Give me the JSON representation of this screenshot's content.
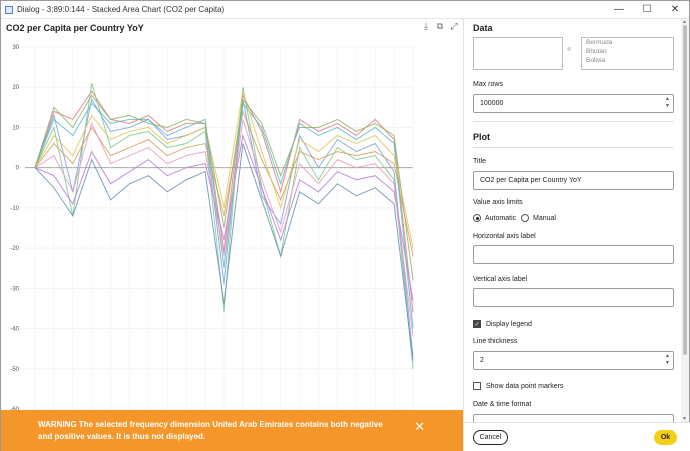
{
  "window": {
    "title": "Dialog - 3:89:0:144 - Stacked Area Chart (CO2 per Capita)",
    "minimize": "—",
    "maximize": "☐",
    "close": "✕"
  },
  "chart_panel": {
    "title": "CO2 per Capita per Country YoY",
    "icons": [
      "download-icon",
      "copy-icon",
      "expand-icon"
    ]
  },
  "chart_data": {
    "type": "line",
    "title": "CO2 per Capita per Country YoY",
    "xlabel": "",
    "ylabel": "",
    "ylim": [
      -60,
      30
    ],
    "yticks": [
      30,
      20,
      10,
      0,
      -10,
      -20,
      -30,
      -40,
      -50,
      -60
    ],
    "ytick_labels": [
      "30",
      "20",
      "10",
      "0",
      "-10",
      "-20",
      "-30",
      "-40",
      "-50",
      "-60"
    ],
    "grid": true,
    "x_points": 20,
    "series": [
      {
        "color": "#7b9de0",
        "values": [
          0,
          13,
          -6,
          17,
          9,
          10,
          12,
          7,
          8,
          10,
          -29,
          17,
          -7,
          -14,
          8,
          0,
          7,
          4,
          6,
          -1,
          -47
        ]
      },
      {
        "color": "#e07b7b",
        "values": [
          0,
          14,
          12,
          19,
          12,
          11,
          13,
          9,
          11,
          11,
          -21,
          18,
          9,
          -6,
          12,
          9,
          11,
          8,
          12,
          7,
          -36
        ]
      },
      {
        "color": "#7bc98a",
        "values": [
          0,
          10,
          -12,
          21,
          5,
          8,
          9,
          5,
          6,
          9,
          -36,
          20,
          -5,
          -22,
          5,
          -3,
          5,
          2,
          3,
          -3,
          -50
        ]
      },
      {
        "color": "#d6a05a",
        "values": [
          0,
          6,
          1,
          10,
          3,
          5,
          7,
          3,
          5,
          6,
          -12,
          14,
          2,
          -8,
          4,
          2,
          4,
          3,
          4,
          1,
          -22
        ]
      },
      {
        "color": "#b57bd6",
        "values": [
          0,
          -2,
          -9,
          4,
          -4,
          -1,
          2,
          -2,
          0,
          1,
          -18,
          8,
          -5,
          -18,
          -3,
          -6,
          -1,
          -3,
          -2,
          -6,
          -33
        ]
      },
      {
        "color": "#5ab8c9",
        "values": [
          0,
          12,
          8,
          16,
          11,
          12,
          12,
          8,
          10,
          12,
          -25,
          16,
          10,
          -4,
          11,
          8,
          10,
          7,
          10,
          6,
          -40
        ]
      },
      {
        "color": "#e0c45a",
        "values": [
          0,
          8,
          3,
          13,
          7,
          9,
          10,
          6,
          8,
          10,
          -10,
          19,
          4,
          -10,
          7,
          4,
          8,
          6,
          8,
          3,
          -20
        ]
      },
      {
        "color": "#e89ac0",
        "values": [
          0,
          3,
          -6,
          11,
          1,
          3,
          5,
          1,
          3,
          4,
          -22,
          12,
          -3,
          -16,
          1,
          -4,
          2,
          0,
          1,
          -4,
          -42
        ]
      },
      {
        "color": "#8fb36a",
        "values": [
          0,
          15,
          10,
          18,
          12,
          13,
          11,
          10,
          12,
          11,
          -15,
          17,
          11,
          -2,
          10,
          10,
          12,
          9,
          11,
          8,
          -28
        ]
      },
      {
        "color": "#6a8fb3",
        "values": [
          0,
          -5,
          -12,
          2,
          -8,
          -4,
          -2,
          -6,
          -3,
          -1,
          -34,
          6,
          -8,
          -22,
          -6,
          -9,
          -4,
          -7,
          -5,
          -9,
          -48
        ]
      }
    ]
  },
  "warning": {
    "text": "WARNING The selected frequency dimension United Arab Emirates contains both negative and positive values. It is thus not displayed.",
    "close": "✕"
  },
  "settings": {
    "data_header": "Data",
    "country_list": [
      "Bermuda",
      "Bhutan",
      "Bolivia"
    ],
    "move_glyph": "«",
    "max_rows_label": "Max rows",
    "max_rows_value": "100000",
    "plot_header": "Plot",
    "title_label": "Title",
    "title_value": "CO2 per Capita per Country YoY",
    "value_axis_limits_label": "Value axis limits",
    "value_axis_options": [
      "Automatic",
      "Manual"
    ],
    "value_axis_selected": "Automatic",
    "horizontal_axis_label": "Horizontal axis label",
    "horizontal_axis_value": "",
    "vertical_axis_label": "Vertical axis label",
    "vertical_axis_value": "",
    "display_legend_label": "Display legend",
    "display_legend_checked": true,
    "line_thickness_label": "Line thickness",
    "line_thickness_value": "2",
    "show_markers_label": "Show data point markers",
    "show_markers_checked": false,
    "datetime_format_label": "Date & time format",
    "spin_up": "▲",
    "spin_down": "▼"
  },
  "footer": {
    "cancel_label": "Cancel",
    "ok_label": "Ok"
  },
  "colors": {
    "warning_bg": "#f5962a",
    "ok_bg": "#f4cf14"
  }
}
